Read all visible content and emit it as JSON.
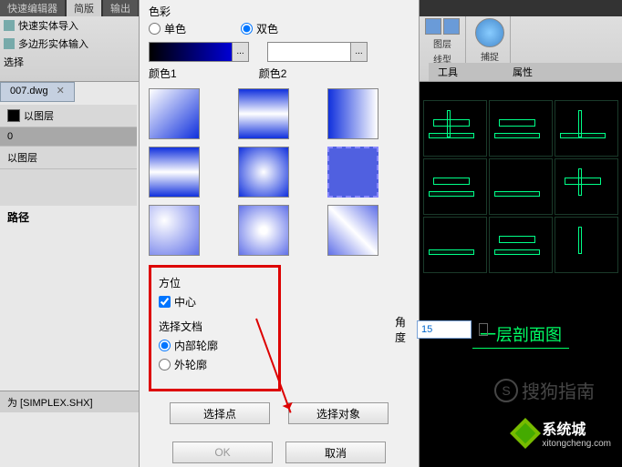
{
  "ribbon": {
    "tabs": [
      "快速编辑器",
      "简版",
      "输出"
    ],
    "left_items": [
      "快速实体导入",
      "多边形实体输入",
      "选择"
    ],
    "right": {
      "group1_items": [
        "图层",
        "线型"
      ],
      "group1_label": "",
      "group2_label": "捕捉",
      "bottom_labels": [
        "工具",
        "属性"
      ]
    }
  },
  "file_tab": {
    "name": "007.dwg"
  },
  "props": {
    "row1": "以图层",
    "row2": "0",
    "row3": "以图层",
    "section": "路径"
  },
  "status": {
    "text": "为 [SIMPLEX.SHX]"
  },
  "dialog": {
    "color_section": "色彩",
    "radio_single": "单色",
    "radio_double": "双色",
    "color1_label": "颜色1",
    "color2_label": "颜色2",
    "orientation": {
      "title": "方位",
      "center": "中心"
    },
    "angle": {
      "label": "角度",
      "value": "15"
    },
    "select_doc": {
      "title": "选择文档",
      "inner": "内部轮廓",
      "outer": "外轮廓"
    },
    "btn_select_point": "选择点",
    "btn_select_object": "选择对象",
    "btn_ok": "OK",
    "btn_cancel": "取消"
  },
  "drawing": {
    "title": "一层剖面图"
  },
  "watermark": {
    "main": "系统城",
    "sub": "xitongcheng.com"
  },
  "sogou": {
    "text": "搜狗指南",
    "s": "S"
  }
}
